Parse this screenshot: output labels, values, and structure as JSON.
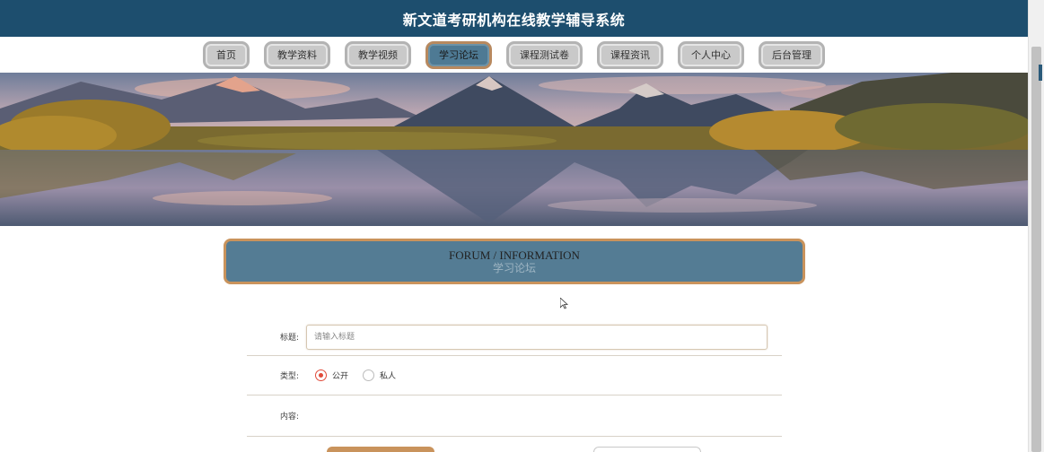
{
  "header": {
    "title": "新文道考研机构在线教学辅导系统"
  },
  "nav": {
    "items": [
      {
        "label": "首页",
        "active": false
      },
      {
        "label": "教学资料",
        "active": false
      },
      {
        "label": "教学视频",
        "active": false
      },
      {
        "label": "学习论坛",
        "active": true
      },
      {
        "label": "课程测试卷",
        "active": false
      },
      {
        "label": "课程资讯",
        "active": false
      },
      {
        "label": "个人中心",
        "active": false
      },
      {
        "label": "后台管理",
        "active": false
      }
    ]
  },
  "banner": {
    "image": "mountain-lake-landscape"
  },
  "section": {
    "title_en": "FORUM / INFORMATION",
    "title_cn": "学习论坛"
  },
  "form": {
    "title_label": "标题:",
    "title_placeholder": "请输入标题",
    "title_value": "",
    "type_label": "类型:",
    "type_options": [
      {
        "label": "公开",
        "checked": true
      },
      {
        "label": "私人",
        "checked": false
      }
    ],
    "content_label": "内容:"
  },
  "colors": {
    "header_bg": "#1d4e6e",
    "active_tab": "#4e7a94",
    "accent_border": "#c9935c",
    "section_bg": "#547c94",
    "radio_checked": "#e04b3a"
  }
}
